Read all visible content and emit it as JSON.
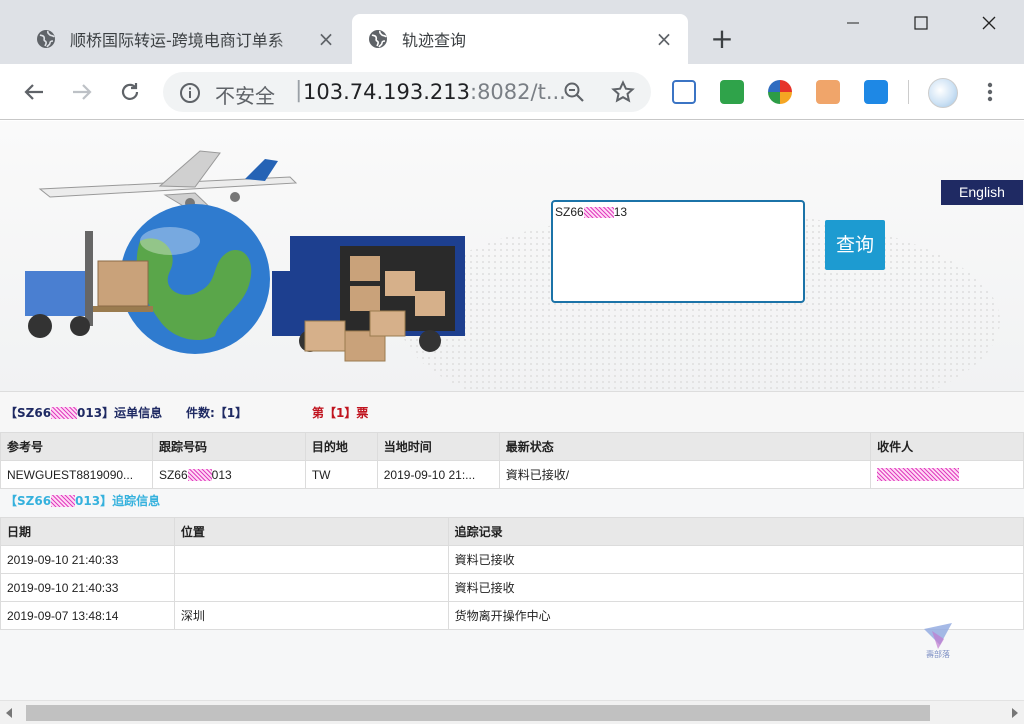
{
  "browser": {
    "tabs": [
      {
        "title": "顺桥国际转运-跨境电商订单系",
        "active": false
      },
      {
        "title": "轨迹查询",
        "active": true
      }
    ],
    "address_bar": {
      "security_label": "不安全",
      "url_host": "103.74.193.213",
      "url_rest": ":8082/t..."
    },
    "icons": [
      "globe-icon",
      "back-arrow-icon",
      "forward-arrow-icon",
      "reload-icon",
      "info-icon",
      "zoom-icon",
      "star-icon",
      "menu-dots-icon"
    ]
  },
  "page": {
    "language_button": "English",
    "search_value": "SZ66",
    "search_value_suffix": "13",
    "query_button": "查询",
    "waybill": {
      "title_prefix": "【SZ66",
      "title_suffix": "013】运单信息",
      "count_label": "件数:【1】",
      "ticket_label": "第【1】票"
    },
    "main_table": {
      "headers": [
        "参考号",
        "跟踪号码",
        "目的地",
        "当地时间",
        "最新状态",
        "收件人"
      ],
      "row": {
        "reference": "NEWGUEST8819090...",
        "tracking_prefix": "SZ66",
        "tracking_suffix": "013",
        "destination": "TW",
        "local_time": "2019-09-10 21:...",
        "latest_status": "資料已接收/"
      }
    },
    "tracking": {
      "title_prefix": "【SZ66",
      "title_suffix": "013】追踪信息",
      "headers": [
        "日期",
        "位置",
        "追踪记录"
      ],
      "rows": [
        {
          "date": "2019-09-10 21:40:33",
          "location": "",
          "record": "資料已接收"
        },
        {
          "date": "2019-09-10 21:40:33",
          "location": "",
          "record": "資料已接收"
        },
        {
          "date": "2019-09-07 13:48:14",
          "location": "深圳",
          "record": "货物离开操作中心"
        }
      ]
    },
    "watermark_text": "壽部落"
  },
  "colors": {
    "brand_navy": "#1f2a63",
    "query_blue": "#1d9bd1",
    "ticket_red": "#c0141f",
    "tracking_cyan": "#35b1dd",
    "mask_magenta": "#e040c0"
  }
}
